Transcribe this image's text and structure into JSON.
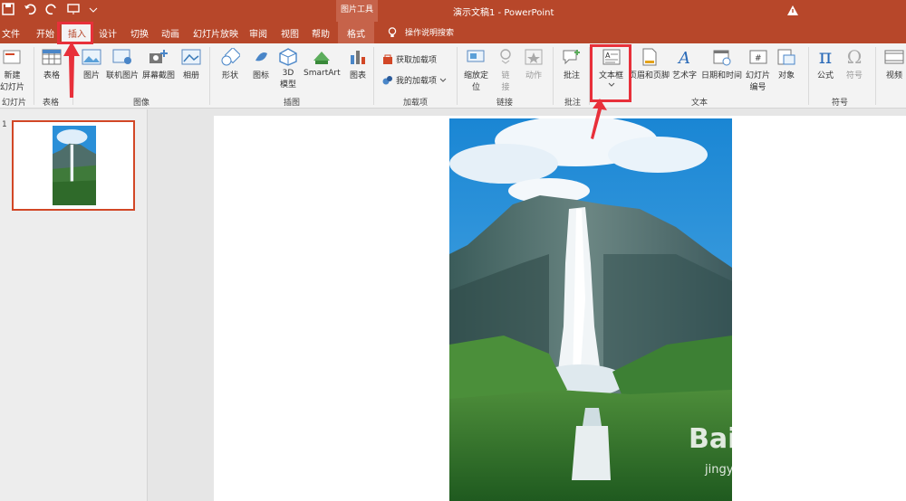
{
  "title_bar": {
    "context_tool": "图片工具",
    "document_title": "演示文稿1  -  PowerPoint"
  },
  "tabs": [
    "文件",
    "开始",
    "插入",
    "设计",
    "切换",
    "动画",
    "幻灯片放映",
    "审阅",
    "视图",
    "帮助",
    "格式"
  ],
  "tell_me": "操作说明搜索",
  "ribbon": {
    "new_slide": "新建\n幻灯片",
    "slides_group": "幻灯片",
    "table": "表格",
    "table_group": "表格",
    "picture": "图片",
    "online_picture": "联机图片",
    "screenshot": "屏幕截图",
    "album": "相册",
    "images_group": "图像",
    "shapes": "形状",
    "icons": "图标",
    "model3d": "3D\n模型",
    "smartart": "SmartArt",
    "chart": "图表",
    "illustrations_group": "插图",
    "get_addins": "获取加载项",
    "my_addins": "我的加载项",
    "addins_group": "加载项",
    "zoom": "缩放定\n位",
    "link": "链\n接",
    "action": "动作",
    "links_group": "链接",
    "comment": "批注",
    "comments_group": "批注",
    "textbox": "文本框",
    "header_footer": "页眉和页脚",
    "wordart": "艺术字",
    "datetime": "日期和时间",
    "slide_number": "幻灯片\n编号",
    "object": "对象",
    "text_group": "文本",
    "equation": "公式",
    "symbol": "符号",
    "symbols_group": "符号",
    "video": "视频"
  },
  "slide_panel": {
    "slide_number": "1"
  },
  "watermark": {
    "brand": "Bai du 经验",
    "url": "jingyan.baidu.com"
  },
  "colors": {
    "accent": "#b7472a",
    "highlight": "#e8303a"
  }
}
